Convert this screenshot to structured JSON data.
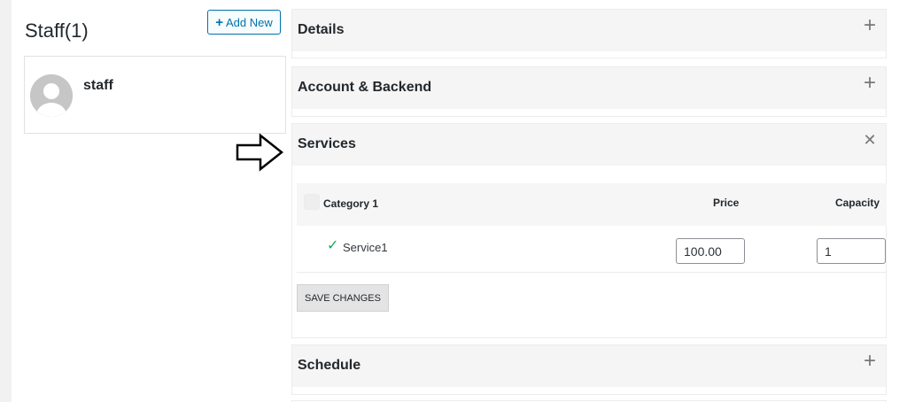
{
  "left": {
    "title": "Staff(1)",
    "add_new_label": "Add New",
    "add_new_icon": "plus-icon",
    "staff_list": [
      {
        "name": "staff",
        "avatar": "avatar-placeholder"
      }
    ]
  },
  "panels": {
    "details": {
      "title": "Details",
      "toggle": "+"
    },
    "account": {
      "title": "Account & Backend",
      "toggle": "+"
    },
    "services": {
      "title": "Services",
      "toggle": "✕",
      "header": {
        "category_label": "Category 1",
        "price_label": "Price",
        "capacity_label": "Capacity"
      },
      "rows": [
        {
          "checked": true,
          "name": "Service1",
          "price": "100.00",
          "capacity": "1"
        }
      ],
      "save_label": "SAVE CHANGES"
    },
    "schedule": {
      "title": "Schedule",
      "toggle": "+"
    }
  },
  "colors": {
    "accent": "#0073aa",
    "check": "#1ea85a",
    "panel_header_bg": "#f5f5f5"
  }
}
